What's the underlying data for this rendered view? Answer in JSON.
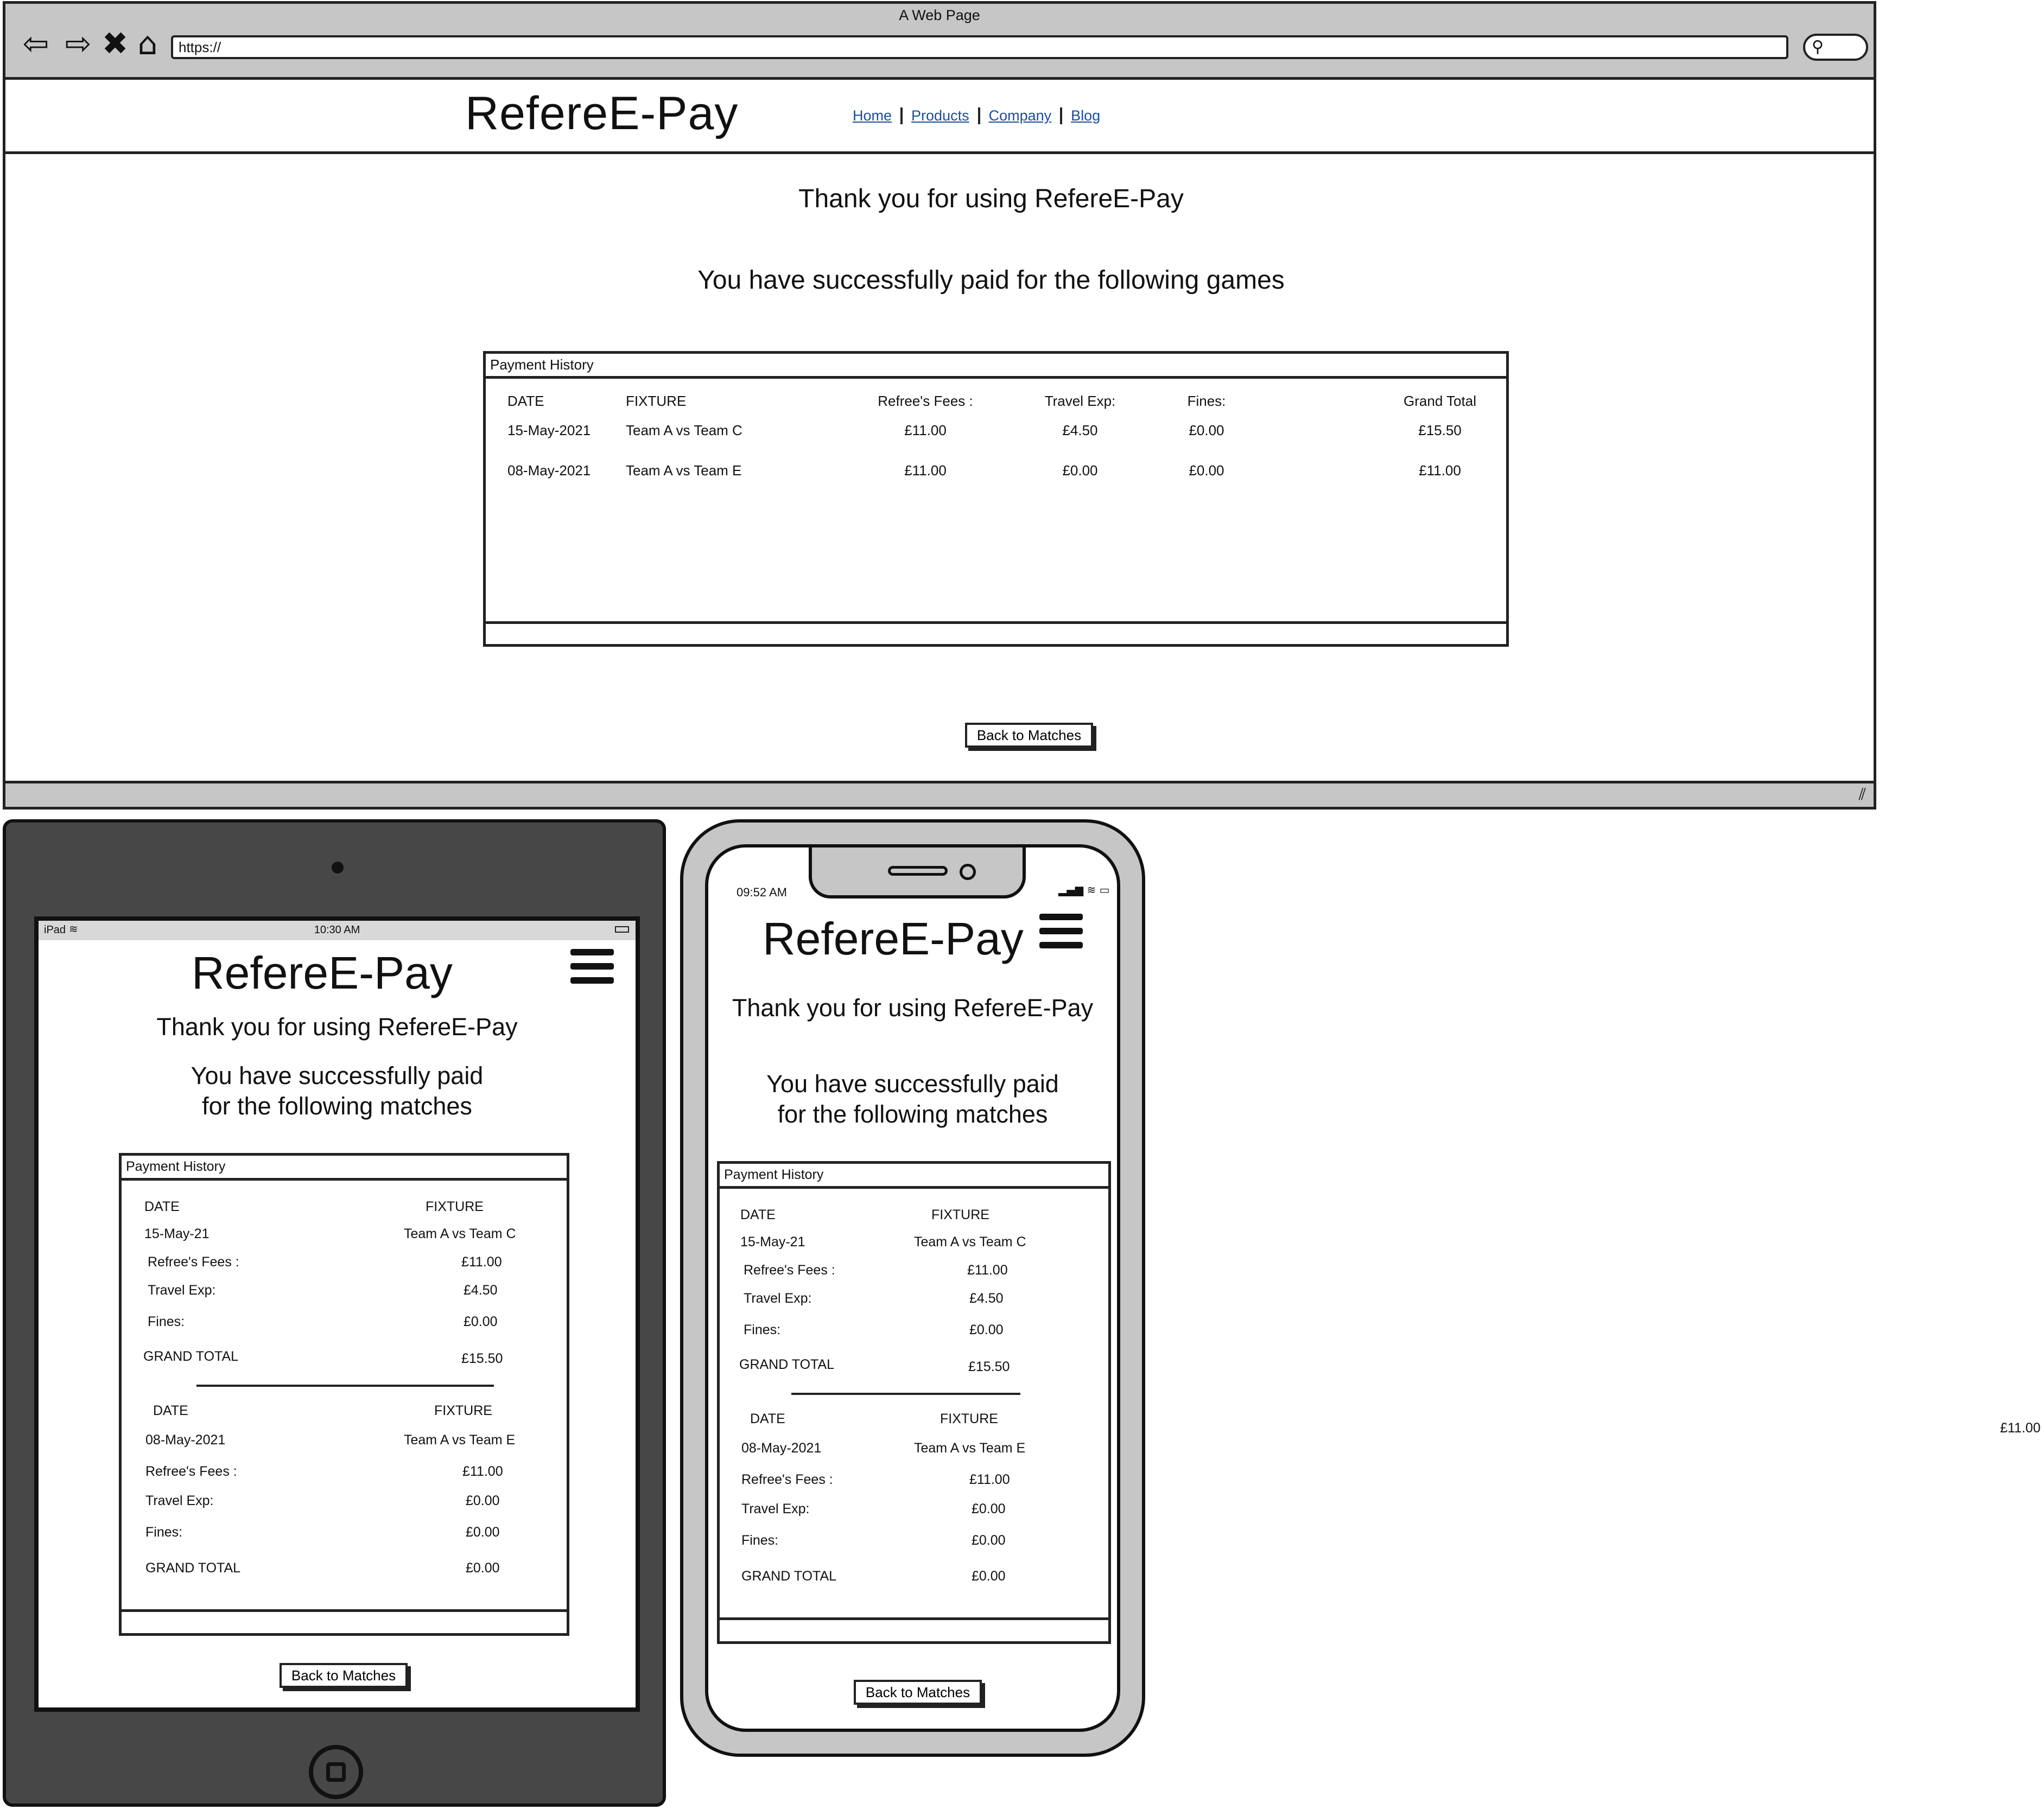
{
  "browser": {
    "window_title": "A Web Page",
    "url": "https://",
    "nav_icons": [
      "back-arrow-icon",
      "forward-arrow-icon",
      "close-icon",
      "home-icon"
    ]
  },
  "site": {
    "logo": "RefereE-Pay",
    "nav": [
      "Home",
      "Products",
      "Company",
      "Blog"
    ]
  },
  "desktop": {
    "thanks": "Thank you for using RefereE-Pay",
    "paid": "You have successfully paid for the following games",
    "table_title": "Payment History",
    "headers": [
      "DATE",
      "FIXTURE",
      "Refree's Fees :",
      "Travel Exp:",
      "Fines:",
      "Grand Total"
    ],
    "rows": [
      [
        "15-May-2021",
        "Team A vs Team C",
        "£11.00",
        "£4.50",
        "£0.00",
        "£15.50"
      ],
      [
        "08-May-2021",
        "Team A vs Team E",
        "£11.00",
        "£0.00",
        "£0.00",
        "£11.00"
      ]
    ],
    "back_button": "Back to Matches"
  },
  "tablet": {
    "status": {
      "device": "iPad",
      "time": "10:30 AM"
    },
    "thanks": "Thank you for using RefereE-Pay",
    "paid_line1": "You have successfully paid",
    "paid_line2": "for the following matches",
    "table_title": "Payment History",
    "records": [
      {
        "date_label": "DATE",
        "fixture_label": "FIXTURE",
        "date": "15-May-21",
        "fixture": "Team A vs Team C",
        "fees_label": "Refree's Fees :",
        "fees": "£11.00",
        "travel_label": "Travel Exp:",
        "travel": "£4.50",
        "fines_label": "Fines:",
        "fines": "£0.00",
        "total_label": "GRAND TOTAL",
        "total": "£15.50"
      },
      {
        "date_label": "DATE",
        "fixture_label": "FIXTURE",
        "date": "08-May-2021",
        "fixture": "Team A vs Team E",
        "fees_label": "Refree's Fees :",
        "fees": "£11.00",
        "travel_label": "Travel Exp:",
        "travel": "£0.00",
        "fines_label": "Fines:",
        "fines": "£0.00",
        "total_label": "GRAND TOTAL",
        "total": "£0.00"
      }
    ],
    "back_button": "Back to Matches"
  },
  "phone": {
    "status": {
      "time": "09:52 AM"
    },
    "thanks": "Thank you for using RefereE-Pay",
    "paid_line1": "You have successfully paid",
    "paid_line2": "for the following matches",
    "table_title": "Payment History",
    "records": [
      {
        "date_label": "DATE",
        "fixture_label": "FIXTURE",
        "date": "15-May-21",
        "fixture": "Team A vs Team C",
        "fees_label": "Refree's Fees :",
        "fees": "£11.00",
        "travel_label": "Travel Exp:",
        "travel": "£4.50",
        "fines_label": "Fines:",
        "fines": "£0.00",
        "total_label": "GRAND TOTAL",
        "total": "£15.50"
      },
      {
        "date_label": "DATE",
        "fixture_label": "FIXTURE",
        "date": "08-May-2021",
        "fixture": "Team A vs Team E",
        "fees_label": "Refree's Fees :",
        "fees": "£11.00",
        "travel_label": "Travel Exp:",
        "travel": "£0.00",
        "fines_label": "Fines:",
        "fines": "£0.00",
        "total_label": "GRAND TOTAL",
        "total": "£0.00"
      }
    ],
    "back_button": "Back to Matches"
  },
  "stray_value": "£11.00"
}
